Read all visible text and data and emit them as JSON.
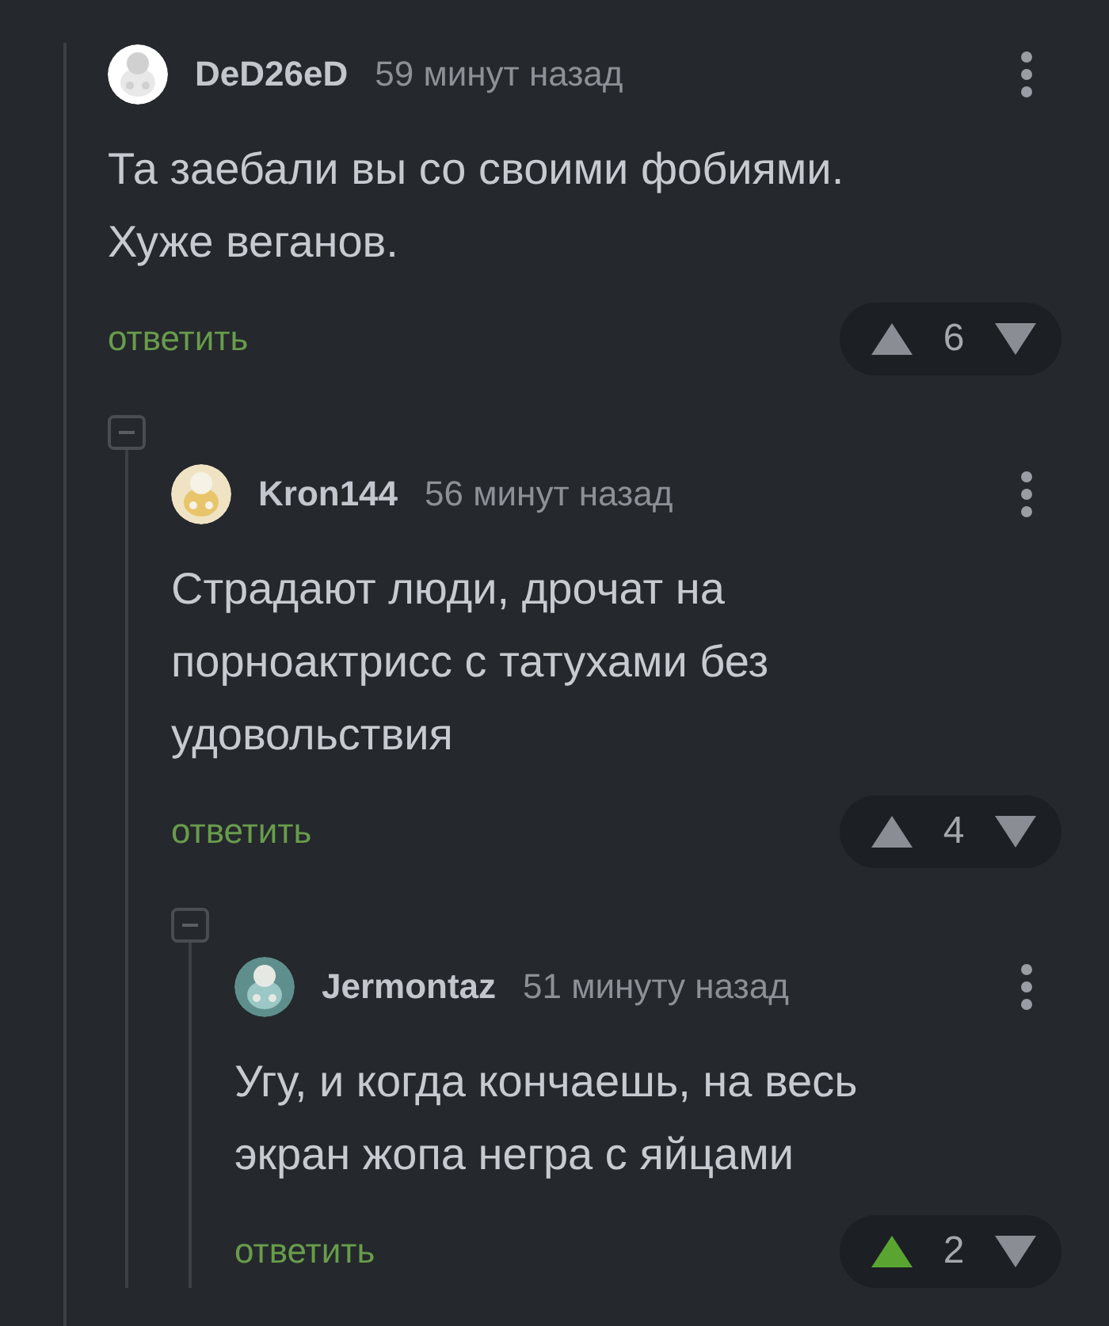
{
  "comments": [
    {
      "user": "DeD26eD",
      "time": "59 минут назад",
      "text": "Та заебали вы со своими фобиями.\nХуже веганов.",
      "reply": "ответить",
      "score": "6",
      "upvoted": false,
      "expanded": true,
      "children": [
        {
          "user": "Kron144",
          "time": "56 минут назад",
          "text": "Страдают люди, дрочат на\nпорноактрисс с татухами без\nудовольствия",
          "reply": "ответить",
          "score": "4",
          "upvoted": false,
          "expanded": true,
          "children": [
            {
              "user": "Jermontaz",
              "time": "51 минуту назад",
              "text": "Угу, и когда кончаешь, на весь\nэкран жопа негра с яйцами",
              "reply": "ответить",
              "score": "2",
              "upvoted": true
            }
          ]
        }
      ]
    }
  ]
}
